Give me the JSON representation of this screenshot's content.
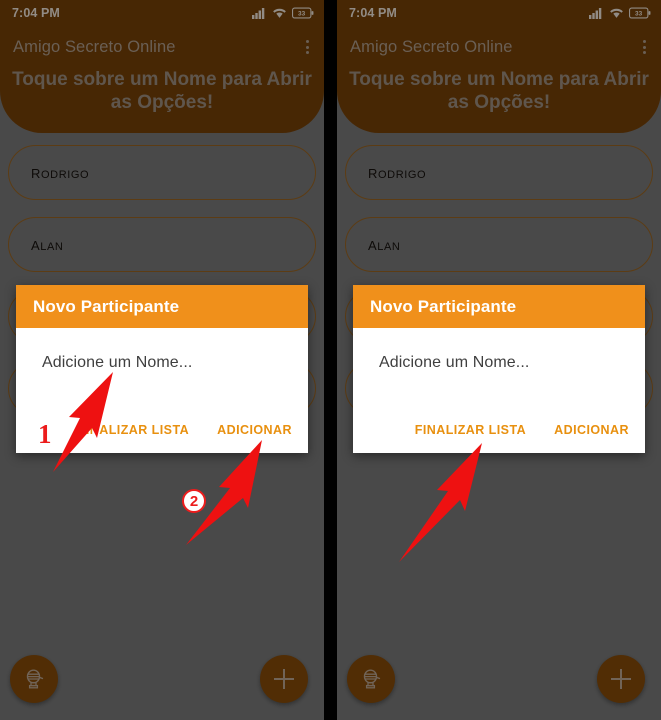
{
  "meta": {
    "panel_count": 2,
    "accent_orange": "#f0901b",
    "brand_brown": "#6b3b07",
    "annotation_red": "#ec1c1c",
    "scrim": "rgba(0,0,0,0.33)"
  },
  "status_bar": {
    "time": "7:04 PM",
    "signal_icon": "signal-bars-icon",
    "wifi_icon": "wifi-icon",
    "battery_icon": "battery-icon",
    "battery_level": "33"
  },
  "app_bar": {
    "title": "Amigo Secreto Online",
    "overflow_icon": "more-vertical-icon"
  },
  "header": {
    "subtitle": "Toque sobre um Nome para Abrir as Opções!"
  },
  "list": {
    "items": [
      {
        "label": "Rodrigo"
      },
      {
        "label": "Alan"
      },
      {
        "label": ""
      },
      {
        "label": ""
      }
    ]
  },
  "fabs": {
    "left": {
      "icon": "raffle-draw-icon",
      "label": ""
    },
    "right": {
      "icon": "plus-icon",
      "label": ""
    }
  },
  "dialog": {
    "title": "Novo Participante",
    "input_placeholder": "Adicione um Nome...",
    "input_value": "",
    "buttons": [
      {
        "label": "FINALIZAR LISTA",
        "name": "finish-list-button"
      },
      {
        "label": "ADICIONAR",
        "name": "add-button"
      }
    ]
  },
  "annotations": {
    "left_panel": [
      {
        "id": "1",
        "style": "plain",
        "target": "name-input"
      },
      {
        "id": "2",
        "style": "circle",
        "target": "add-button"
      }
    ],
    "right_panel": [
      {
        "id": "",
        "style": "none",
        "target": "finish-list-button"
      }
    ]
  }
}
